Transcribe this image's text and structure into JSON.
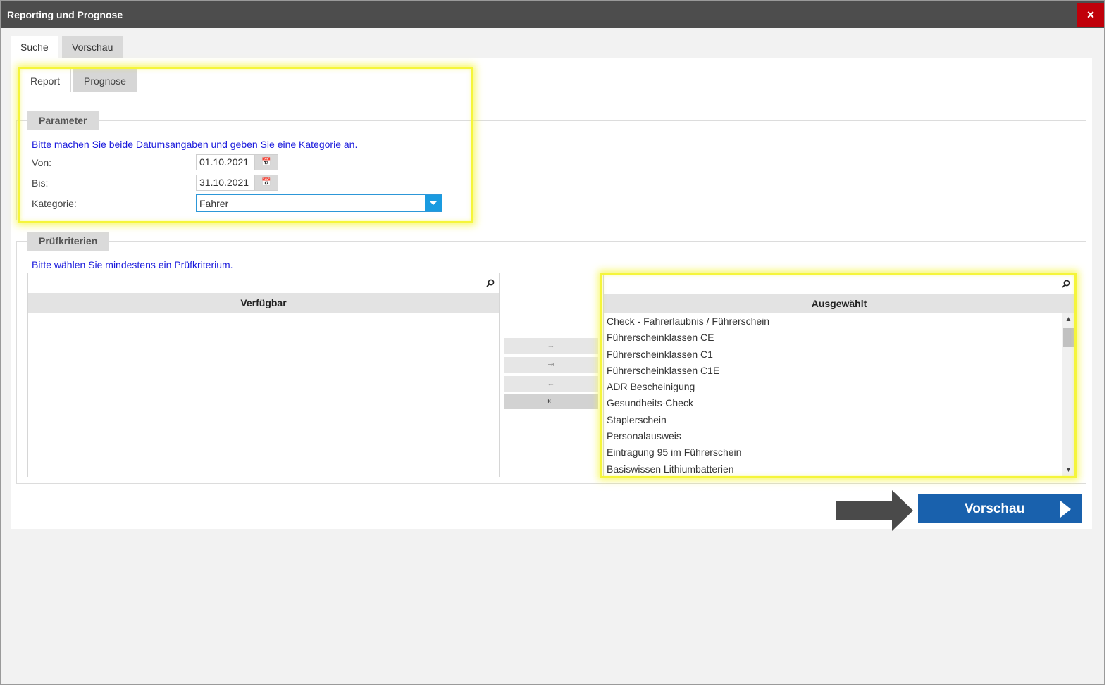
{
  "window": {
    "title": "Reporting und Prognose",
    "close_icon": "×"
  },
  "tabs": [
    {
      "label": "Suche",
      "active": true
    },
    {
      "label": "Vorschau",
      "active": false
    }
  ],
  "subtabs": [
    {
      "label": "Report",
      "active": true
    },
    {
      "label": "Prognose",
      "active": false
    }
  ],
  "parameter": {
    "legend": "Parameter",
    "hint": "Bitte machen Sie beide Datumsangaben und geben Sie eine Kategorie an.",
    "von_label": "Von:",
    "von_value": "01.10.2021",
    "bis_label": "Bis:",
    "bis_value": "31.10.2021",
    "kategorie_label": "Kategorie:",
    "kategorie_value": "Fahrer"
  },
  "pruefkriterien": {
    "legend": "Prüfkriterien",
    "hint": "Bitte wählen Sie mindestens ein Prüfkriterium.",
    "available_header": "Verfügbar",
    "selected_header": "Ausgewählt",
    "available_items": [],
    "selected_items": [
      "Check - Fahrerlaubnis / Führerschein",
      "Führerscheinklassen CE",
      "Führerscheinklassen C1",
      "Führerscheinklassen C1E",
      "ADR Bescheinigung",
      "Gesundheits-Check",
      "Staplerschein",
      "Personalausweis",
      "Eintragung 95 im Führerschein",
      "Basiswissen Lithiumbatterien"
    ],
    "move_buttons": [
      {
        "icon": "→",
        "icon_name": "move-right-icon"
      },
      {
        "icon": "⇥",
        "icon_name": "move-all-right-icon"
      },
      {
        "icon": "←",
        "icon_name": "move-left-icon"
      },
      {
        "icon": "⇤",
        "icon_name": "move-all-left-icon"
      }
    ]
  },
  "footer": {
    "preview_label": "Vorschau"
  },
  "colors": {
    "titlebar": "#4d4d4d",
    "close": "#c0000a",
    "accent_blue": "#1961ad",
    "hint_text": "#1a1adc",
    "highlight": "#f5f53a"
  }
}
